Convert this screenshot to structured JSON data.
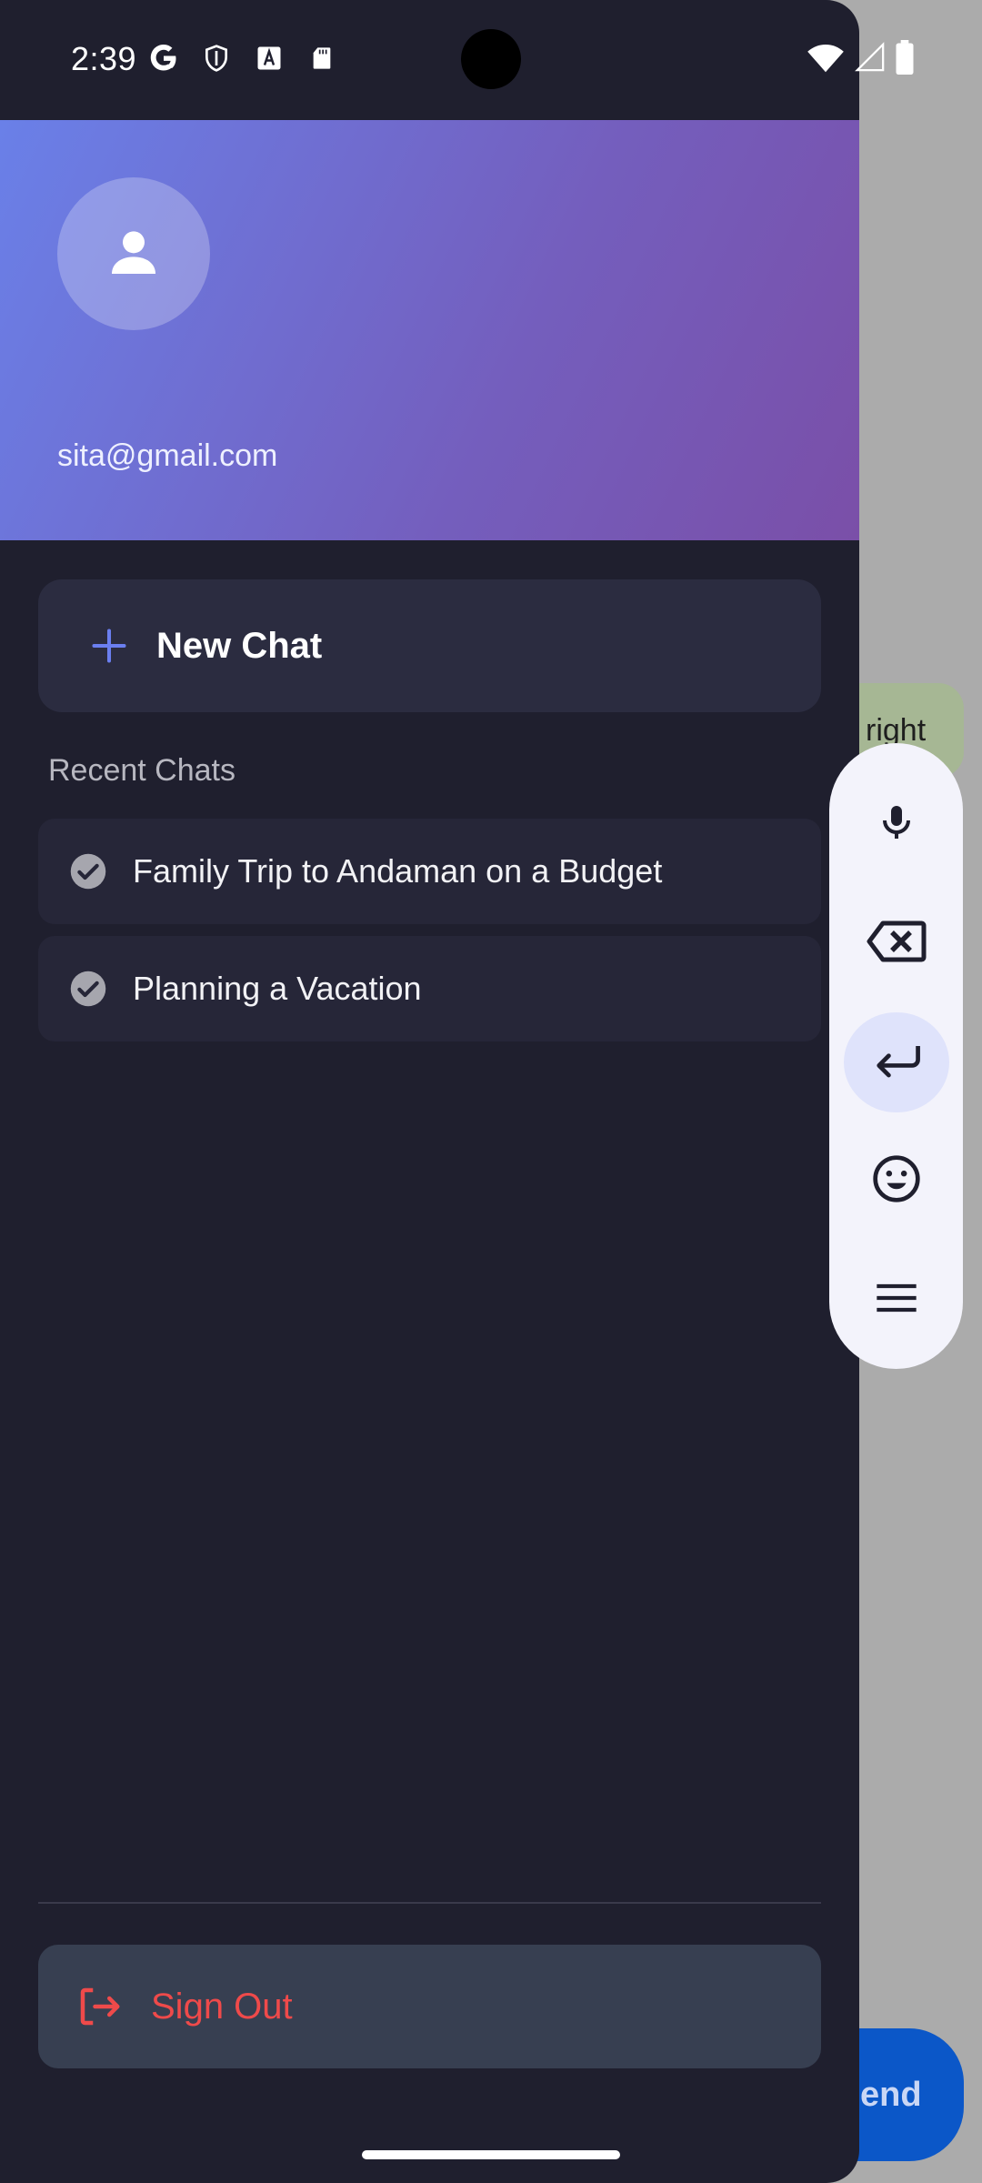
{
  "status_bar": {
    "time": "2:39",
    "icons": [
      "google-icon",
      "shield-icon",
      "font-icon",
      "sd-card-icon",
      "wifi-icon",
      "signal-icon",
      "battery-icon"
    ]
  },
  "drawer": {
    "header": {
      "email": "sita@gmail.com",
      "avatar_icon": "person-icon",
      "gradient": [
        "#6a80e8",
        "#7a4fa8"
      ]
    },
    "new_chat": {
      "label": "New Chat",
      "icon": "plus-icon",
      "accent": "#6b7ff0"
    },
    "recent_section": {
      "title": "Recent Chats",
      "items": [
        {
          "title": "Family Trip to Andaman on a Budget",
          "icon": "check-circle-icon"
        },
        {
          "title": "Planning a Vacation",
          "icon": "check-circle-icon"
        }
      ]
    },
    "sign_out": {
      "label": "Sign Out",
      "icon": "logout-icon",
      "color": "#ef4a4a"
    }
  },
  "background": {
    "bubble_text": "right",
    "send_label": "end"
  },
  "keyboard_toolbar": {
    "buttons": [
      "mic-icon",
      "backspace-icon",
      "enter-icon",
      "emoji-icon",
      "menu-icon"
    ]
  }
}
